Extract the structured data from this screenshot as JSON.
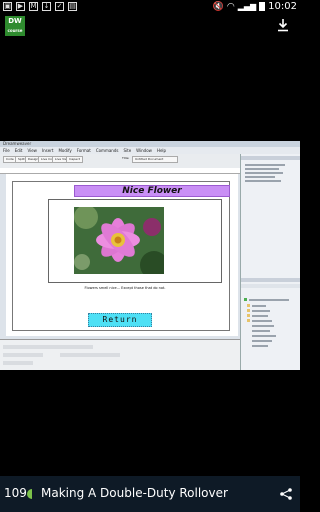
{
  "status_bar": {
    "time": "10:02",
    "left_icons": [
      "picture-icon",
      "play-icon",
      "mail-icon",
      "download-icon",
      "check-icon",
      "screenshot-icon"
    ]
  },
  "app": {
    "logo_text_top": "DW",
    "logo_text_bottom": "course"
  },
  "video": {
    "dw_title": "Dreamweaver",
    "menu": [
      "File",
      "Edit",
      "View",
      "Insert",
      "Modify",
      "Format",
      "Commands",
      "Site",
      "Window",
      "Help"
    ],
    "toolbar": [
      "Code",
      "Split",
      "Design",
      "Live Code",
      "Live View",
      "Inspect",
      "Title:",
      "Untitled Document"
    ],
    "page_heading": "Nice Flower",
    "caption": "Flowers smell nice... Except those that do not.",
    "return_label": "Return"
  },
  "footer": {
    "count": "109",
    "title": "Making A Double-Duty Rollover"
  },
  "colors": {
    "banner": "#c98ff5",
    "return_button": "#4ee0f5",
    "footer_bg": "#0e1a26",
    "accent_dot": "#7cc24a"
  }
}
